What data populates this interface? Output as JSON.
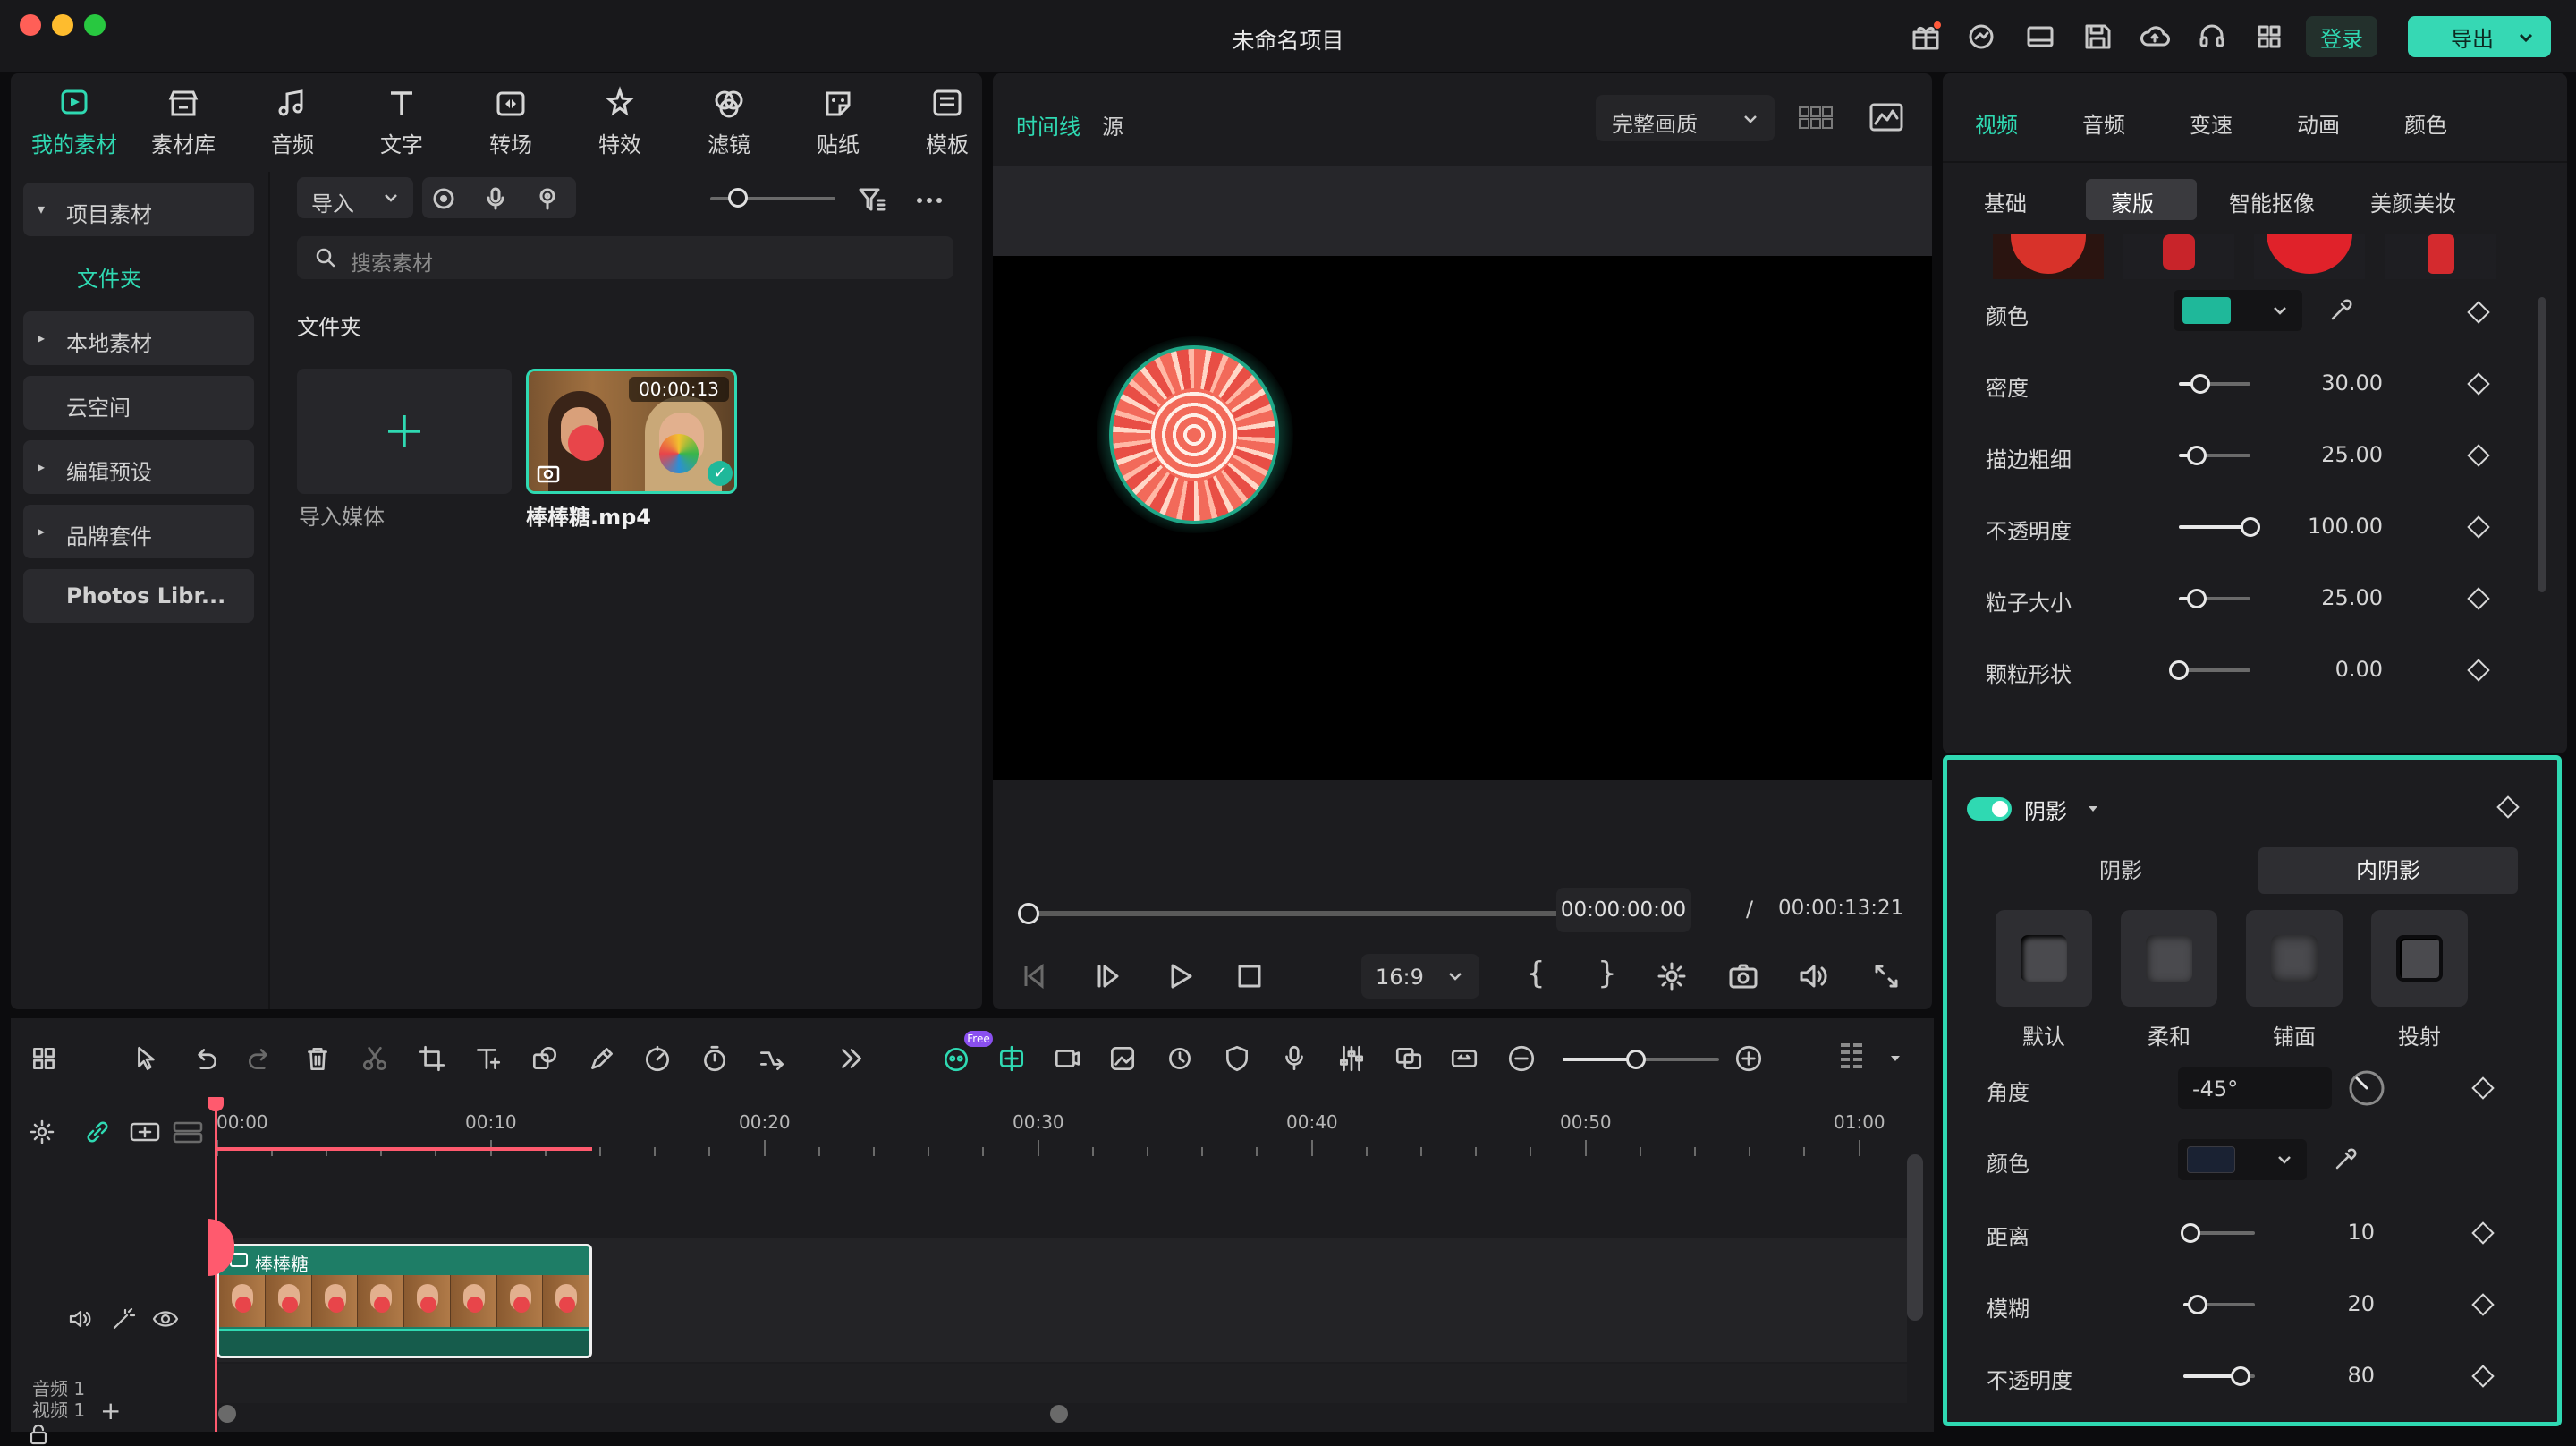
{
  "window": {
    "title": "未命名项目",
    "login": "登录",
    "export": "导出"
  },
  "media_tabs": [
    {
      "label": "我的素材",
      "icon": "my-media-icon",
      "active": true
    },
    {
      "label": "素材库",
      "icon": "stock-icon"
    },
    {
      "label": "音频",
      "icon": "music-icon"
    },
    {
      "label": "文字",
      "icon": "text-icon"
    },
    {
      "label": "转场",
      "icon": "transition-icon"
    },
    {
      "label": "特效",
      "icon": "effects-icon"
    },
    {
      "label": "滤镜",
      "icon": "filter-icon"
    },
    {
      "label": "贴纸",
      "icon": "sticker-icon"
    },
    {
      "label": "模板",
      "icon": "template-icon"
    }
  ],
  "sidebar": {
    "project_media": "项目素材",
    "folder": "文件夹",
    "local_media": "本地素材",
    "cloud": "云空间",
    "presets": "编辑预设",
    "brand": "品牌套件",
    "photos": "Photos Libr..."
  },
  "media": {
    "import": "导入",
    "search_placeholder": "搜索素材",
    "folder_heading": "文件夹",
    "import_media": "导入媒体",
    "clip_name": "棒棒糖.mp4",
    "clip_duration": "00:00:13"
  },
  "preview": {
    "tab_timeline": "时间线",
    "tab_source": "源",
    "quality": "完整画质",
    "current_time": "00:00:00:00",
    "separator": "/",
    "total_time": "00:00:13:21",
    "ratio": "16:9",
    "progress": 0
  },
  "inspector": {
    "tabs": [
      "视频",
      "音频",
      "变速",
      "动画",
      "颜色"
    ],
    "subtabs": [
      "基础",
      "蒙版",
      "智能抠像",
      "美颜美妆"
    ],
    "props": [
      {
        "label": "颜色",
        "type": "color",
        "color": "#1fb89a"
      },
      {
        "label": "密度",
        "value": "30.00",
        "level": 0.3
      },
      {
        "label": "描边粗细",
        "value": "25.00",
        "level": 0.25
      },
      {
        "label": "不透明度",
        "value": "100.00",
        "level": 1.0
      },
      {
        "label": "粒子大小",
        "value": "25.00",
        "level": 0.25
      },
      {
        "label": "颗粒形状",
        "value": "0.00",
        "level": 0.0
      }
    ],
    "shadow": {
      "title": "阴影",
      "tab_shadow": "阴影",
      "tab_inner": "内阴影",
      "presets": [
        "默认",
        "柔和",
        "铺面",
        "投射"
      ],
      "angle_label": "角度",
      "angle_value": "-45°",
      "color_label": "颜色",
      "color": "#1a2233",
      "distance_label": "距离",
      "distance_value": "10",
      "distance_level": 0.1,
      "blur_label": "模糊",
      "blur_value": "20",
      "blur_level": 0.2,
      "opacity_label": "不透明度",
      "opacity_value": "80",
      "opacity_level": 0.8
    }
  },
  "timeline": {
    "ruler": [
      "00:00",
      "00:10",
      "00:20",
      "00:30",
      "00:40",
      "00:50",
      "01:00"
    ],
    "video_track": "视频 1",
    "audio_track": "音频 1",
    "clip_label": "棒棒糖",
    "free_badge": "Free"
  },
  "colors": {
    "accent": "#2fd9b2",
    "playhead": "#ff5a6e",
    "clip": "#1e7d66"
  }
}
